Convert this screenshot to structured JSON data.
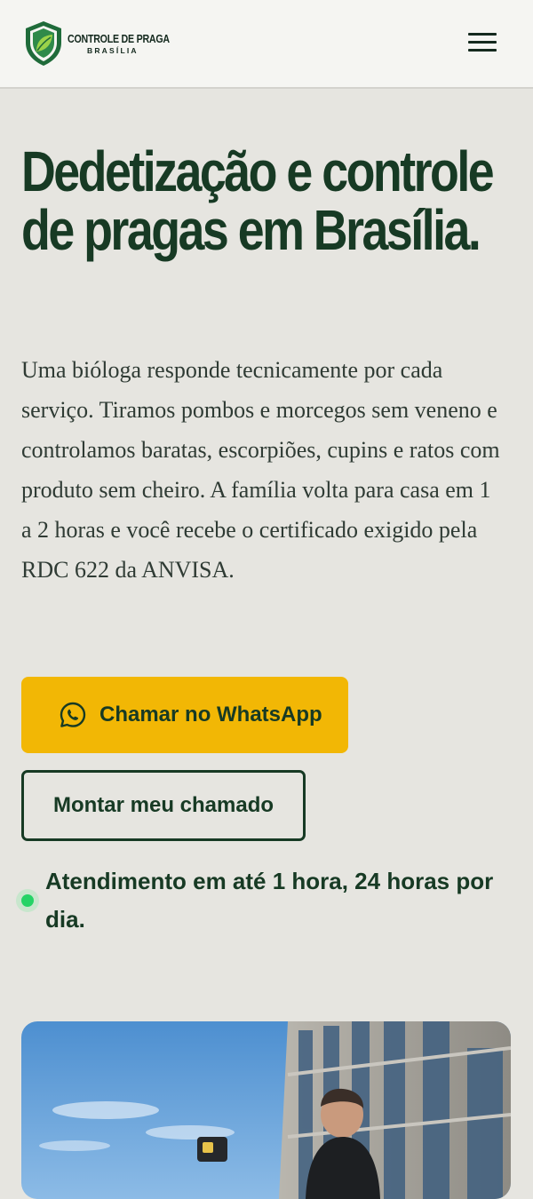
{
  "header": {
    "brand_name": "CONTROLE DE PRAGA",
    "brand_sub": "BRASÍLIA",
    "logo_icon": "shield-leaf-icon",
    "menu_icon": "hamburger-icon"
  },
  "hero": {
    "title": "Dedetização e controle de pragas em Brasília.",
    "description": "Uma bióloga responde tecnicamente por cada serviço. Tiramos pombos e morcegos sem veneno e controlamos baratas, escorpiões, cupins e ratos com produto sem cheiro. A família volta para casa em 1 a 2 horas e você recebe o certificado exigido pela RDC 622 da ANVISA.",
    "whatsapp_button": "Chamar no WhatsApp",
    "whatsapp_icon": "whatsapp-icon",
    "chamado_button": "Montar meu chamado",
    "status_text": "Atendimento em até 1 hora, 24 horas por dia."
  },
  "colors": {
    "primary_green": "#173a24",
    "accent_yellow": "#f2b705",
    "background": "#e6e5e0",
    "status_green": "#25d366"
  }
}
